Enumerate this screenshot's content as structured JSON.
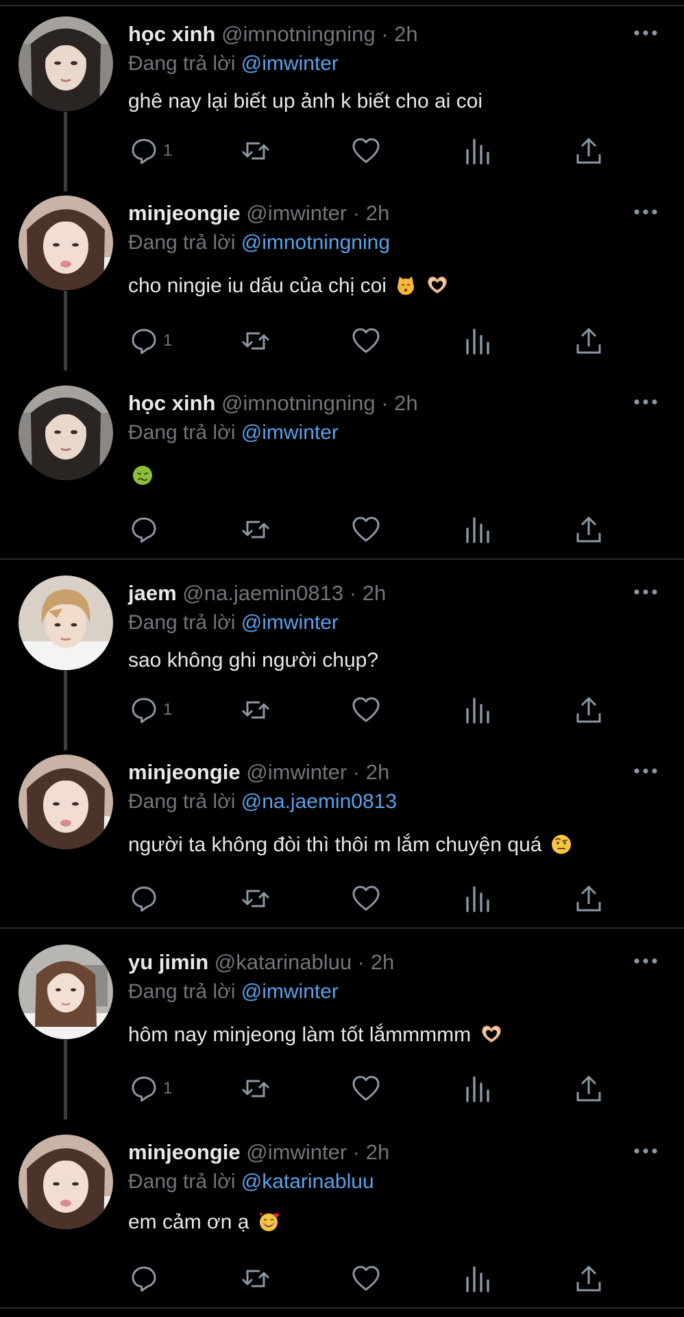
{
  "colors": {
    "background": "#000000",
    "text": "#e7e9ea",
    "muted": "#71767b",
    "mention": "#5aa1ea",
    "separator": "#2a2d31",
    "icon": "#8b98a5"
  },
  "tweets": [
    {
      "name": "học xinh",
      "handle": "@imnotningning",
      "dot": "·",
      "time": "2h",
      "reply_prefix": "Đang trả lời",
      "reply_to": "@imwinter",
      "text": "ghê nay lại biết up ảnh k biết cho ai coi",
      "emoji": "",
      "reply_count": "1",
      "avatar": "avatar-girl-dark-hair"
    },
    {
      "name": "minjeongie",
      "handle": "@imwinter",
      "dot": "·",
      "time": "2h",
      "reply_prefix": "Đang trả lời",
      "reply_to": "@imnotningning",
      "text": "cho ningie iu dấu của chị coi",
      "emoji": "kissing-cat-emoji heart-hands-emoji",
      "reply_count": "1",
      "avatar": "avatar-girl-pout"
    },
    {
      "name": "học xinh",
      "handle": "@imnotningning",
      "dot": "·",
      "time": "2h",
      "reply_prefix": "Đang trả lời",
      "reply_to": "@imwinter",
      "text": "",
      "emoji": "nauseated-face-emoji",
      "reply_count": "",
      "avatar": "avatar-girl-dark-hair"
    },
    {
      "name": "jaem",
      "handle": "@na.jaemin0813",
      "dot": "·",
      "time": "2h",
      "reply_prefix": "Đang trả lời",
      "reply_to": "@imwinter",
      "text": "sao không ghi người chụp?",
      "emoji": "",
      "reply_count": "1",
      "avatar": "avatar-boy-light-hair"
    },
    {
      "name": "minjeongie",
      "handle": "@imwinter",
      "dot": "·",
      "time": "2h",
      "reply_prefix": "Đang trả lời",
      "reply_to": "@na.jaemin0813",
      "text": "người ta không đòi thì thôi m lắm chuyện quá",
      "emoji": "raised-eyebrow-emoji",
      "reply_count": "",
      "avatar": "avatar-girl-pout"
    },
    {
      "name": "yu jimin",
      "handle": "@katarinabluu",
      "dot": "·",
      "time": "2h",
      "reply_prefix": "Đang trả lời",
      "reply_to": "@imwinter",
      "text": "hôm nay minjeong làm tốt lắmmmmm",
      "emoji": "heart-hands-emoji",
      "reply_count": "1",
      "avatar": "avatar-girl-brown-hair"
    },
    {
      "name": "minjeongie",
      "handle": "@imwinter",
      "dot": "·",
      "time": "2h",
      "reply_prefix": "Đang trả lời",
      "reply_to": "@katarinabluu",
      "text": "em cảm ơn ạ",
      "emoji": "smiling-face-with-hearts-emoji",
      "reply_count": "",
      "avatar": "avatar-girl-pout"
    }
  ]
}
